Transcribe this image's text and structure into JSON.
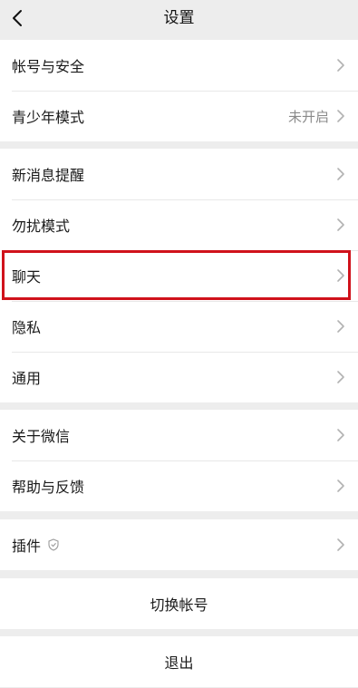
{
  "header": {
    "title": "设置",
    "back_icon": "chevron-left-icon"
  },
  "groups": [
    {
      "items": [
        {
          "label": "帐号与安全",
          "value": ""
        },
        {
          "label": "青少年模式",
          "value": "未开启"
        }
      ]
    },
    {
      "items": [
        {
          "label": "新消息提醒",
          "value": ""
        },
        {
          "label": "勿扰模式",
          "value": ""
        },
        {
          "label": "聊天",
          "value": ""
        },
        {
          "label": "隐私",
          "value": ""
        },
        {
          "label": "通用",
          "value": ""
        }
      ]
    },
    {
      "items": [
        {
          "label": "关于微信",
          "value": ""
        },
        {
          "label": "帮助与反馈",
          "value": ""
        }
      ]
    },
    {
      "items": [
        {
          "label": "插件",
          "value": "",
          "badge_icon": "shield-icon"
        }
      ]
    }
  ],
  "actions": {
    "switch_account": "切换帐号",
    "logout": "退出"
  },
  "colors": {
    "background": "#ededed",
    "cell": "#ffffff",
    "highlight": "#d0121b",
    "secondary_text": "#8a8a8a"
  },
  "highlighted_item": "聊天"
}
